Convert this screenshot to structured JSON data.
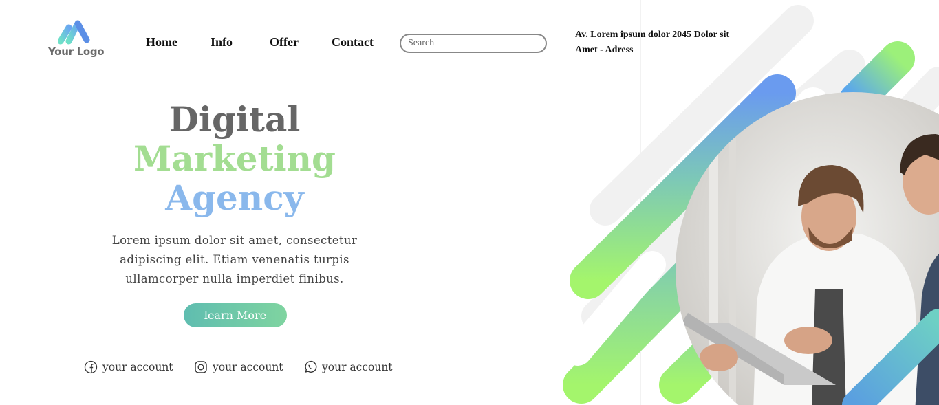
{
  "logo": {
    "text": "Your Logo"
  },
  "nav": {
    "items": [
      "Home",
      "Info",
      "Offer",
      "Contact"
    ]
  },
  "search": {
    "placeholder": "Search"
  },
  "address": {
    "line1": "Av. Lorem ipsum dolor 2045 Dolor sit",
    "line2": "Amet - Adress"
  },
  "hero": {
    "title_line1": "Digital",
    "title_line2": "Marketing",
    "title_line3": "Agency",
    "description_line1": "Lorem ipsum dolor sit amet, consectetur",
    "description_line2": "adipiscing elit. Etiam venenatis turpis",
    "description_line3": "ullamcorper nulla imperdiet finibus.",
    "cta_label": "learn More"
  },
  "social": [
    {
      "icon": "facebook-icon",
      "label": "your account"
    },
    {
      "icon": "instagram-icon",
      "label": "your account"
    },
    {
      "icon": "whatsapp-icon",
      "label": "your account"
    }
  ],
  "colors": {
    "title_gray": "#666666",
    "title_green": "#a3dd92",
    "title_blue": "#8ab8ec",
    "gradient_blue": "#6a9bef",
    "gradient_green": "#a4f56c",
    "button_teal": "#5fbdb0"
  }
}
